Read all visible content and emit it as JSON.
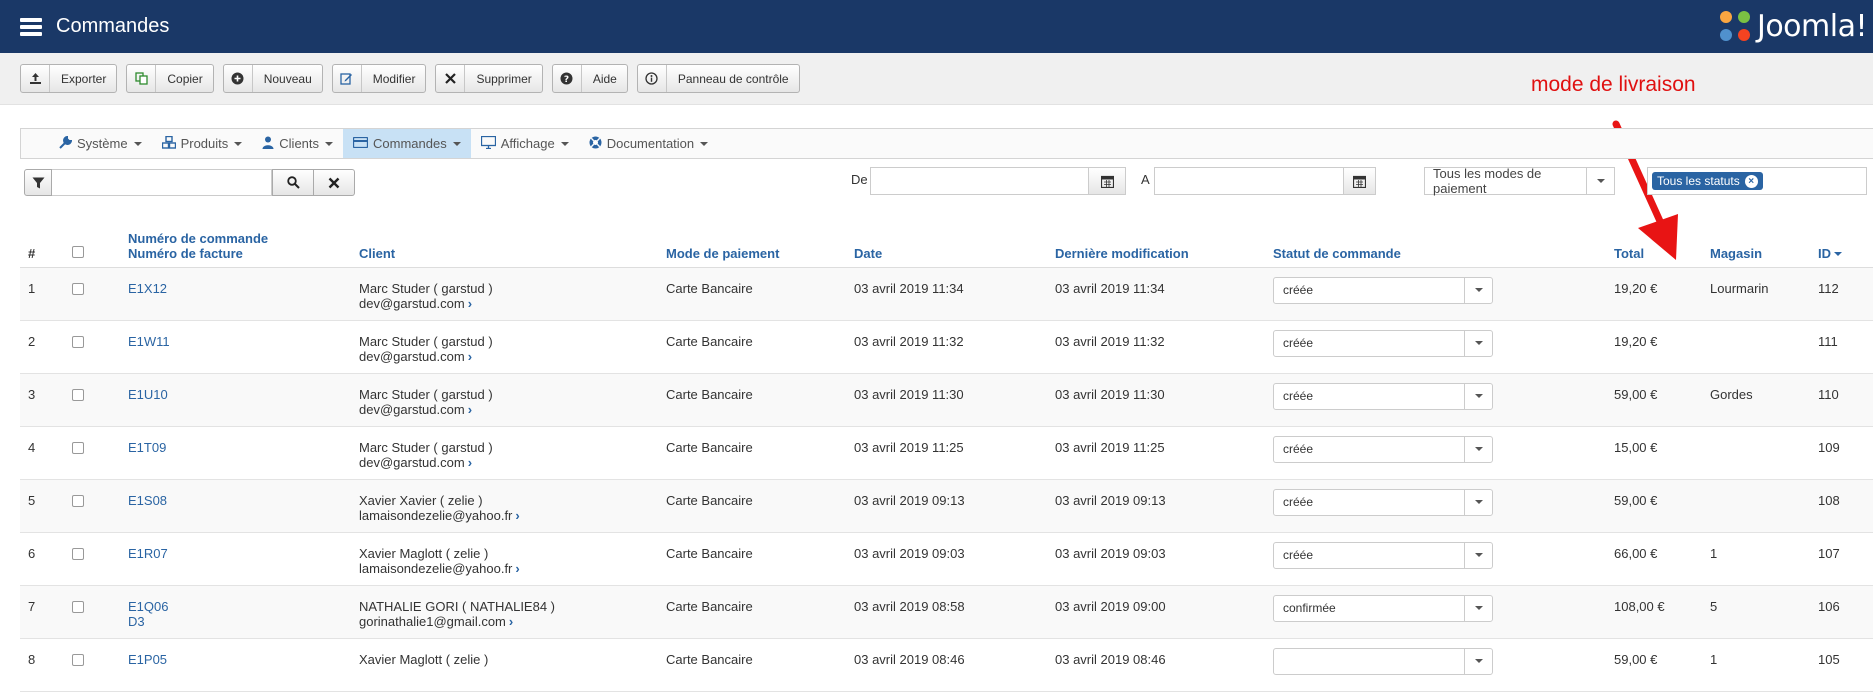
{
  "header": {
    "title": "Commandes",
    "logo_text": "Joomla!"
  },
  "toolbar": {
    "buttons": [
      {
        "label": "Exporter",
        "icon": "upload-icon"
      },
      {
        "label": "Copier",
        "icon": "copy-icon"
      },
      {
        "label": "Nouveau",
        "icon": "plus-circle-icon"
      },
      {
        "label": "Modifier",
        "icon": "edit-icon"
      },
      {
        "label": "Supprimer",
        "icon": "times-icon"
      },
      {
        "label": "Aide",
        "icon": "question-icon"
      },
      {
        "label": "Panneau de contrôle",
        "icon": "info-icon"
      }
    ]
  },
  "annotation": {
    "text": "mode de livraison",
    "color": "#e01010"
  },
  "nav": {
    "items": [
      {
        "label": "Système",
        "icon": "wrench-icon"
      },
      {
        "label": "Produits",
        "icon": "cubes-icon"
      },
      {
        "label": "Clients",
        "icon": "user-icon"
      },
      {
        "label": "Commandes",
        "icon": "credit-card-icon",
        "active": true
      },
      {
        "label": "Affichage",
        "icon": "monitor-icon"
      },
      {
        "label": "Documentation",
        "icon": "help-circle-icon"
      }
    ]
  },
  "filters": {
    "search_value": "",
    "date_from_label": "De",
    "date_to_label": "A",
    "payment_select": "Tous les modes de paiement",
    "status_tag": "Tous les statuts"
  },
  "table": {
    "headers": {
      "num": "#",
      "order_number": "Numéro de commande",
      "invoice_number": "Numéro de facture",
      "client": "Client",
      "payment": "Mode de paiement",
      "date": "Date",
      "modified": "Dernière modification",
      "status": "Statut de commande",
      "total": "Total",
      "store": "Magasin",
      "id": "ID"
    },
    "rows": [
      {
        "num": "1",
        "order": "E1X12",
        "invoice": "",
        "client": "Marc Studer ( garstud )",
        "email": "dev@garstud.com",
        "payment": "Carte Bancaire",
        "date": "03 avril 2019 11:34",
        "modified": "03 avril 2019 11:34",
        "status": "créée",
        "total": "19,20 €",
        "store": "Lourmarin",
        "id": "112"
      },
      {
        "num": "2",
        "order": "E1W11",
        "invoice": "",
        "client": "Marc Studer ( garstud )",
        "email": "dev@garstud.com",
        "payment": "Carte Bancaire",
        "date": "03 avril 2019 11:32",
        "modified": "03 avril 2019 11:32",
        "status": "créée",
        "total": "19,20 €",
        "store": "",
        "id": "111"
      },
      {
        "num": "3",
        "order": "E1U10",
        "invoice": "",
        "client": "Marc Studer ( garstud )",
        "email": "dev@garstud.com",
        "payment": "Carte Bancaire",
        "date": "03 avril 2019 11:30",
        "modified": "03 avril 2019 11:30",
        "status": "créée",
        "total": "59,00 €",
        "store": "Gordes",
        "id": "110"
      },
      {
        "num": "4",
        "order": "E1T09",
        "invoice": "",
        "client": "Marc Studer ( garstud )",
        "email": "dev@garstud.com",
        "payment": "Carte Bancaire",
        "date": "03 avril 2019 11:25",
        "modified": "03 avril 2019 11:25",
        "status": "créée",
        "total": "15,00 €",
        "store": "",
        "id": "109"
      },
      {
        "num": "5",
        "order": "E1S08",
        "invoice": "",
        "client": "Xavier Xavier ( zelie )",
        "email": "lamaisondezelie@yahoo.fr",
        "payment": "Carte Bancaire",
        "date": "03 avril 2019 09:13",
        "modified": "03 avril 2019 09:13",
        "status": "créée",
        "total": "59,00 €",
        "store": "",
        "id": "108"
      },
      {
        "num": "6",
        "order": "E1R07",
        "invoice": "",
        "client": "Xavier Maglott ( zelie )",
        "email": "lamaisondezelie@yahoo.fr",
        "payment": "Carte Bancaire",
        "date": "03 avril 2019 09:03",
        "modified": "03 avril 2019 09:03",
        "status": "créée",
        "total": "66,00 €",
        "store": "1",
        "id": "107"
      },
      {
        "num": "7",
        "order": "E1Q06",
        "invoice": "D3",
        "client": "NATHALIE GORI ( NATHALIE84 )",
        "email": "gorinathalie1@gmail.com",
        "payment": "Carte Bancaire",
        "date": "03 avril 2019 08:58",
        "modified": "03 avril 2019 09:00",
        "status": "confirmée",
        "total": "108,00 €",
        "store": "5",
        "id": "106"
      },
      {
        "num": "8",
        "order": "E1P05",
        "invoice": "",
        "client": "Xavier Maglott ( zelie )",
        "email": "",
        "payment": "Carte Bancaire",
        "date": "03 avril 2019 08:46",
        "modified": "03 avril 2019 08:46",
        "status": "",
        "total": "59,00 €",
        "store": "1",
        "id": "105"
      }
    ]
  }
}
